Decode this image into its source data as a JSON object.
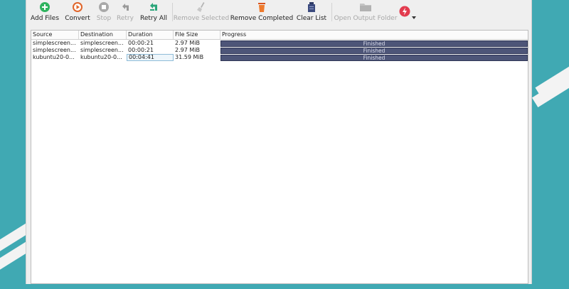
{
  "toolbar": {
    "add_files": "Add Files",
    "convert": "Convert",
    "stop": "Stop",
    "retry": "Retry",
    "retry_all": "Retry All",
    "remove_selected": "Remove Selected",
    "remove_completed": "Remove Completed",
    "clear_list": "Clear List",
    "open_output_folder": "Open Output Folder"
  },
  "colors": {
    "accent_green": "#2fb35e",
    "accent_orange": "#e0652a",
    "accent_teal": "#2aa57a",
    "accent_red": "#e23b4e",
    "progress_fill": "#4d5578",
    "background": "#40a9b3"
  },
  "table": {
    "columns": [
      "Source",
      "Destination",
      "Duration",
      "File Size",
      "Progress"
    ],
    "rows": [
      {
        "source": "simplescreen...",
        "destination": "simplescreen...",
        "duration": "00:00:21",
        "size": "2.97 MiB",
        "progress": "Finished",
        "progress_value": 1.0
      },
      {
        "source": "simplescreen...",
        "destination": "simplescreen...",
        "duration": "00:00:21",
        "size": "2.97 MiB",
        "progress": "Finished",
        "progress_value": 1.0
      },
      {
        "source": "kubuntu20-0...",
        "destination": "kubuntu20-0...",
        "duration": "00:04:41",
        "size": "31.59 MiB",
        "progress": "Finished",
        "progress_value": 1.0
      }
    ]
  }
}
